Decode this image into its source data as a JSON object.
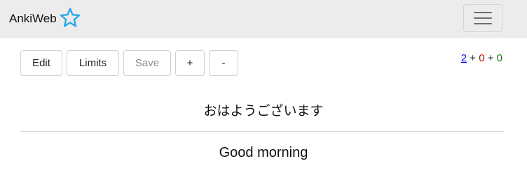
{
  "navbar": {
    "brand": "AnkiWeb",
    "brand_icon": "star-outline-icon",
    "brand_icon_color": "#2aa8e8",
    "menu_icon": "hamburger-menu-icon"
  },
  "toolbar": {
    "edit_label": "Edit",
    "limits_label": "Limits",
    "save_label": "Save",
    "plus_label": "+",
    "minus_label": "-"
  },
  "counts": {
    "new": "2",
    "learn": "0",
    "review": "0",
    "separator": "+",
    "colors": {
      "new": "#0000ee",
      "learn": "#c00000",
      "review": "#008000"
    }
  },
  "card": {
    "front": "おはようございます",
    "back": "Good morning"
  }
}
